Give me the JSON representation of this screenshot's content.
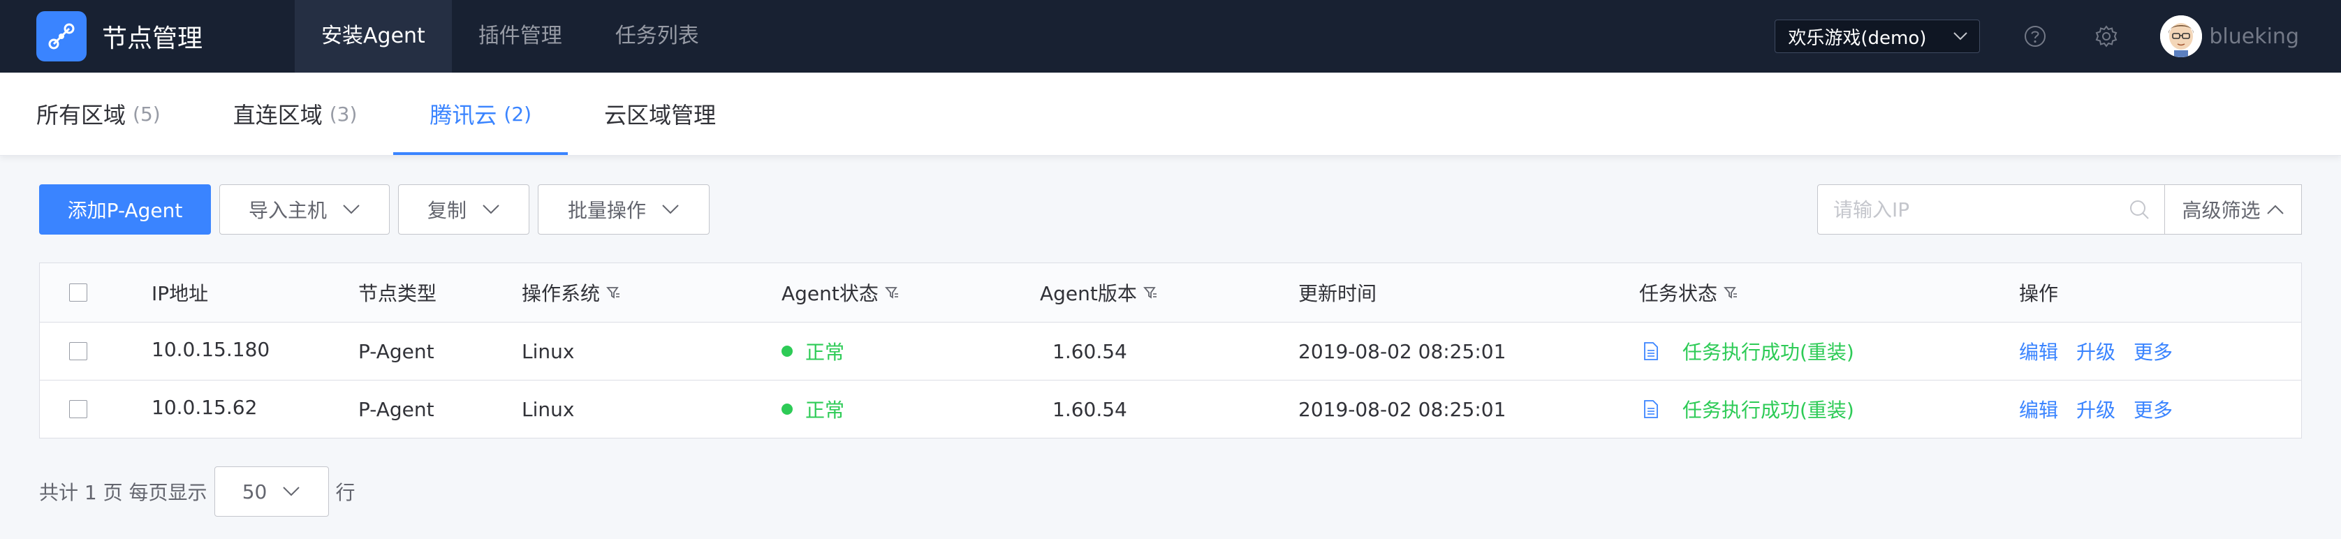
{
  "app": {
    "title": "节点管理"
  },
  "nav": {
    "items": [
      {
        "label": "安装Agent",
        "active": true
      },
      {
        "label": "插件管理",
        "active": false
      },
      {
        "label": "任务列表",
        "active": false
      }
    ]
  },
  "topbar": {
    "business_select": "欢乐游戏(demo)",
    "username": "blueking",
    "icons": [
      "help-icon",
      "gear-icon"
    ]
  },
  "subtabs": [
    {
      "label": "所有区域",
      "count": "(5)",
      "active": false
    },
    {
      "label": "直连区域",
      "count": "(3)",
      "active": false
    },
    {
      "label": "腾讯云",
      "count": "(2)",
      "active": true
    },
    {
      "label": "云区域管理",
      "count": "",
      "active": false
    }
  ],
  "toolbar": {
    "add_label": "添加P-Agent",
    "import_label": "导入主机",
    "copy_label": "复制",
    "batch_label": "批量操作",
    "search_placeholder": "请输入IP",
    "adv_filter_label": "高级筛选"
  },
  "table": {
    "headers": {
      "ip": "IP地址",
      "type": "节点类型",
      "os": "操作系统",
      "status": "Agent状态",
      "version": "Agent版本",
      "time": "更新时间",
      "task": "任务状态",
      "ops": "操作"
    },
    "rows": [
      {
        "ip": "10.0.15.180",
        "type": "P-Agent",
        "os": "Linux",
        "status": "正常",
        "version": "1.60.54",
        "time": "2019-08-02 08:25:01",
        "task": "任务执行成功(重装)",
        "op_edit": "编辑",
        "op_upgrade": "升级",
        "op_more": "更多"
      },
      {
        "ip": "10.0.15.62",
        "type": "P-Agent",
        "os": "Linux",
        "status": "正常",
        "version": "1.60.54",
        "time": "2019-08-02 08:25:01",
        "task": "任务执行成功(重装)",
        "op_edit": "编辑",
        "op_upgrade": "升级",
        "op_more": "更多"
      }
    ]
  },
  "pagination": {
    "total_text": "共计 1 页 每页显示",
    "page_size": "50",
    "suffix": "行"
  },
  "colors": {
    "topbar_bg": "#182132",
    "primary": "#3a84ff",
    "success": "#2dcb56"
  }
}
